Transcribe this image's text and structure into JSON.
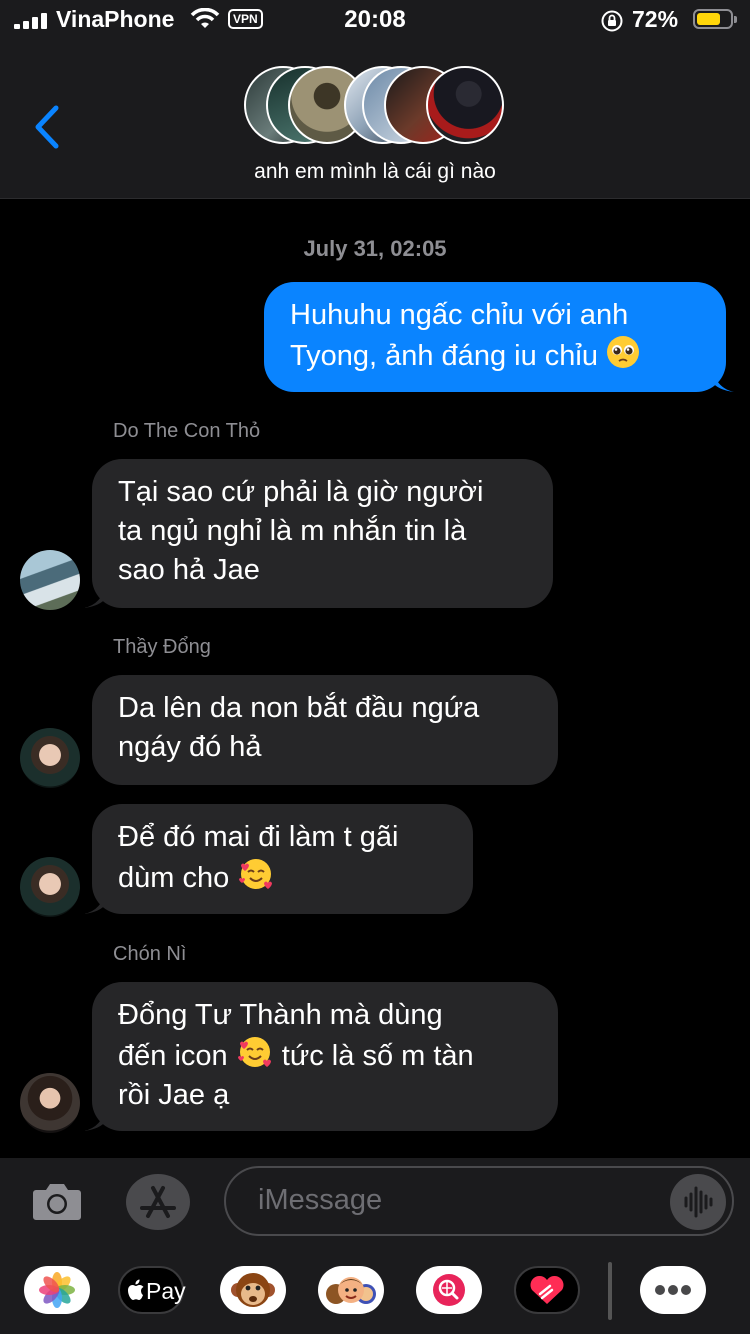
{
  "status_bar": {
    "carrier": "VinaPhone",
    "vpn": "VPN",
    "time": "20:08",
    "battery": "72%",
    "battery_level": 0.72
  },
  "header": {
    "group_name": "anh em mình là cái gì nào"
  },
  "conversation": {
    "timestamp": "July 31, 02:05",
    "messages": [
      {
        "from": "me",
        "lines": [
          "Huhuhu ngấc chỉu với anh",
          "Tyong, ảnh đáng iu chỉu"
        ],
        "emoji": "pleading-face"
      },
      {
        "sender": "Do The Con Thỏ",
        "lines": [
          "Tại sao cứ phải là giờ người",
          "ta ngủ nghỉ là m nhắn tin là",
          "sao hả Jae"
        ]
      },
      {
        "sender": "Thầy Đổng",
        "lines": [
          "Da lên da non bắt đầu ngứa",
          "ngáy đó hả"
        ]
      },
      {
        "lines": [
          "Để đó mai đi làm t gãi",
          "dùm cho"
        ],
        "emoji": "smiling-face-with-hearts"
      },
      {
        "sender": "Chón Nì",
        "lines": [
          "Đổng Tư Thành mà dùng",
          "đến icon",
          "tức là số m tàn",
          "rồi Jae ạ"
        ],
        "emoji": "smiling-face-with-hearts"
      }
    ]
  },
  "composer": {
    "placeholder": "iMessage"
  },
  "dock": {
    "apps": [
      "photos-app",
      "apple-pay-app",
      "monkey-emoji-app",
      "memoji-app",
      "web-search-app",
      "digital-touch-app",
      "more-apps"
    ],
    "pay_label": "Pay"
  },
  "colors": {
    "my_bubble": "#0a84ff",
    "their_bubble": "#262628",
    "background": "#000000",
    "bars": "#1b1b1d"
  }
}
